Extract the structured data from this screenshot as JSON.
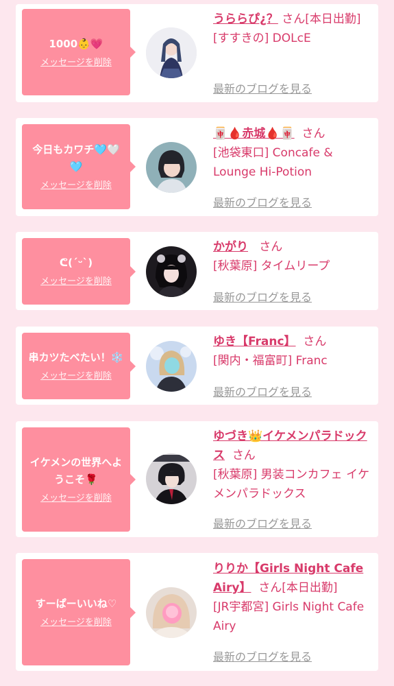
{
  "cards": [
    {
      "bubble_message": "1000👶💗",
      "delete_label": "メッセージを削除",
      "name": "うららぴ¿？",
      "honorific": "さん",
      "status": "[本日出勤]",
      "shop": "[すすきの] DOLcE",
      "blog_label": "最新のブログを見る"
    },
    {
      "bubble_message": "今日もカワチ🩵🤍🩵",
      "delete_label": "メッセージを削除",
      "name": "🀄🩸赤城🩸🀄",
      "honorific": "さん",
      "status": "",
      "shop": "[池袋東口] Concafe & Lounge Hi-Potion",
      "blog_label": "最新のブログを見る"
    },
    {
      "bubble_message": "ᕦ(ˊᵕˋ)",
      "delete_label": "メッセージを削除",
      "name": "かがり",
      "honorific": "さん",
      "status": "",
      "shop": "[秋葉原] タイムリープ",
      "blog_label": "最新のブログを見る"
    },
    {
      "bubble_message": "串カツたべたい！❄️",
      "delete_label": "メッセージを削除",
      "name": "ゆき【Franc】",
      "honorific": "さん",
      "status": "",
      "shop": "[関内・福富町] Franc",
      "blog_label": "最新のブログを見る"
    },
    {
      "bubble_message": "イケメンの世界へようこそ🌹",
      "delete_label": "メッセージを削除",
      "name": "ゆづき👑イケメンパラドックス",
      "honorific": "さん",
      "status": "",
      "shop": "[秋葉原] 男装コンカフェ イケメンパラドックス",
      "blog_label": "最新のブログを見る"
    },
    {
      "bubble_message": "すーぱーいいね♡",
      "delete_label": "メッセージを削除",
      "name": "りりか【Girls Night Cafe Airy】",
      "honorific": "さん",
      "status": "[本日出勤]",
      "shop": "[JR宇都宮] Girls Night Cafe Airy",
      "blog_label": "最新のブログを見る"
    }
  ]
}
